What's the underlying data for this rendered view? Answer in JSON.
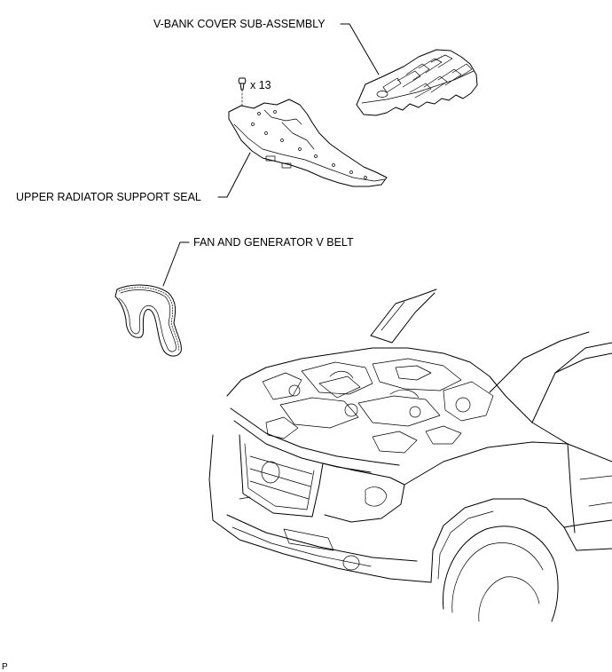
{
  "labels": {
    "v_bank_cover": "V-BANK COVER SUB-ASSEMBLY",
    "clip_count": "x 13",
    "upper_radiator_seal": "UPPER RADIATOR SUPPORT SEAL",
    "fan_belt": "FAN AND GENERATOR V BELT",
    "corner_mark": "P"
  }
}
